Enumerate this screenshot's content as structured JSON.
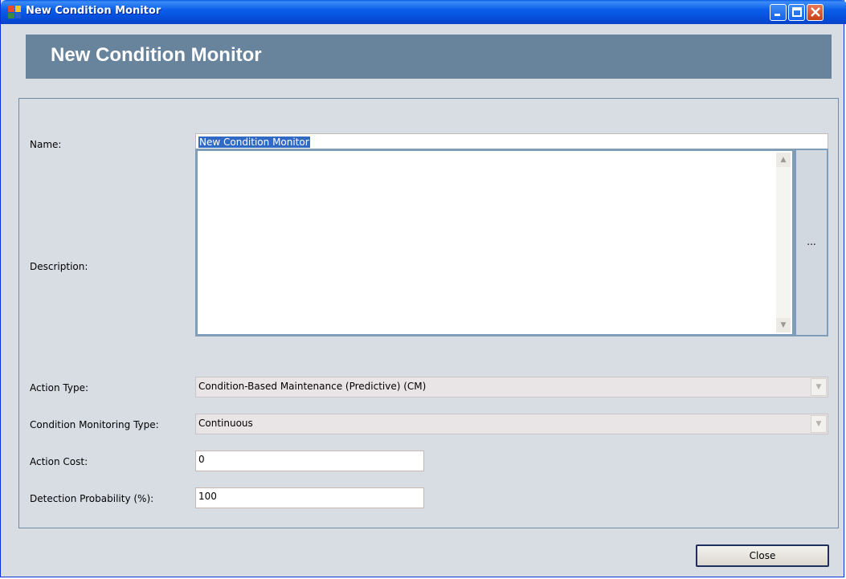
{
  "window": {
    "title": "New Condition Monitor"
  },
  "header": {
    "title": "New Condition Monitor"
  },
  "form": {
    "name": {
      "label": "Name:",
      "value": "New Condition Monitor"
    },
    "description": {
      "label": "Description:",
      "value": "",
      "ellipsis_label": "..."
    },
    "action_type": {
      "label": "Action Type:",
      "value": "Condition-Based Maintenance (Predictive) (CM)"
    },
    "cm_type": {
      "label": "Condition Monitoring Type:",
      "value": "Continuous"
    },
    "action_cost": {
      "label": "Action Cost:",
      "value": "0"
    },
    "detection_probability": {
      "label": "Detection Probability (%):",
      "value": "100"
    }
  },
  "footer": {
    "close_label": "Close"
  }
}
